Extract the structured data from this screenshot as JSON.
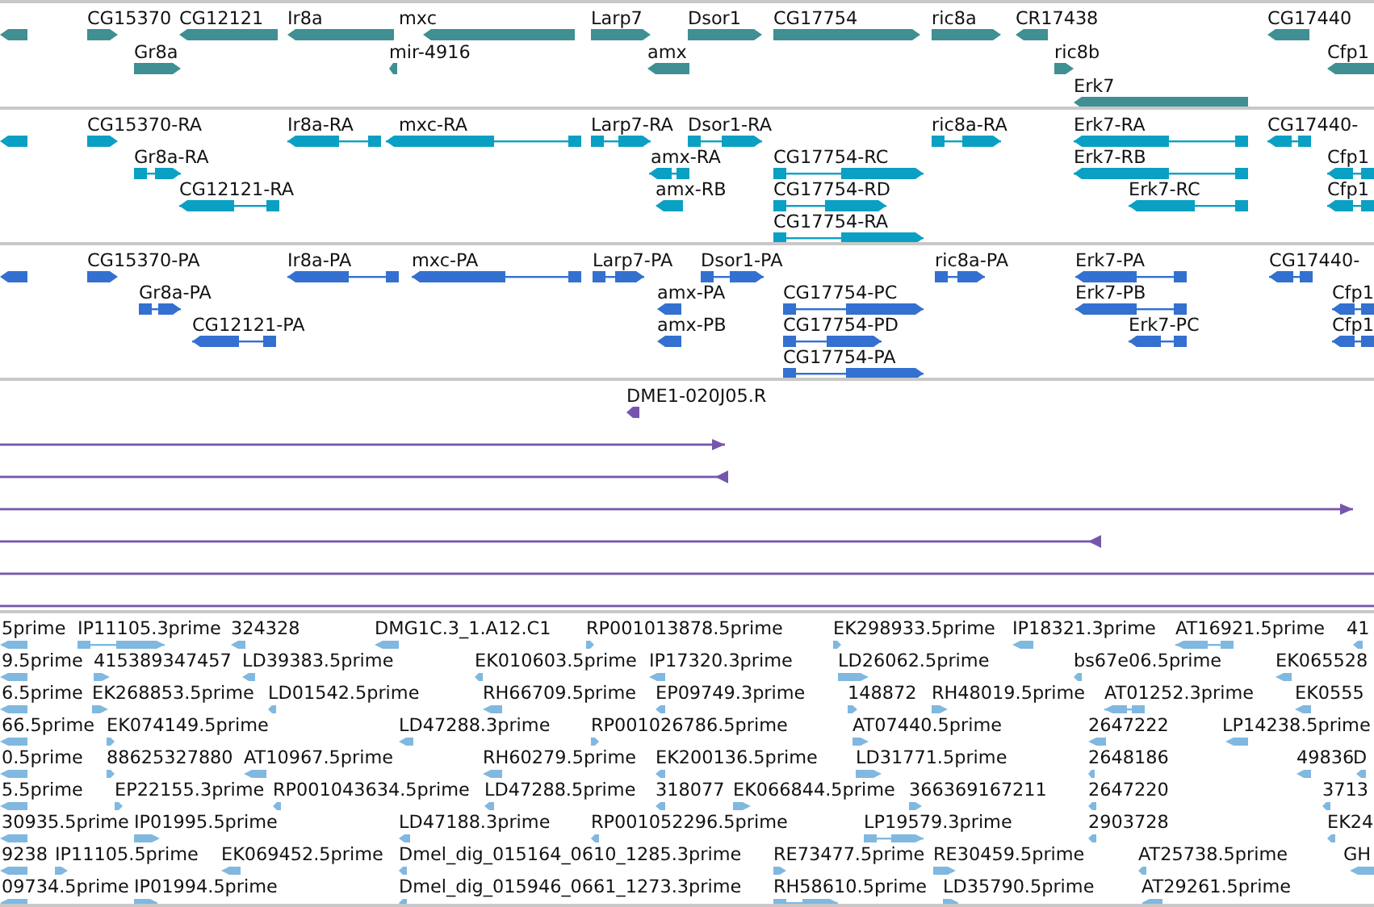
{
  "tracks": [
    {
      "kind": "gene",
      "color": "#3f8f93",
      "features": [
        {
          "reverse": true
        },
        {
          "label": "CG15370",
          "reverse": false
        },
        {
          "label": "CG12121",
          "reverse": true
        },
        {
          "label": "Ir8a",
          "reverse": true
        },
        {
          "label": "mxc",
          "reverse": true
        },
        {
          "label": "Larp7",
          "reverse": false
        },
        {
          "label": "Dsor1",
          "reverse": false
        },
        {
          "label": "CG17754",
          "reverse": false
        },
        {
          "label": "ric8a",
          "reverse": false
        },
        {
          "label": "CR17438",
          "reverse": true
        },
        {
          "label": "CG17440",
          "reverse": true
        },
        {
          "label": "Gr8a",
          "reverse": false
        },
        {
          "label": "mir-4916",
          "reverse": true
        },
        {
          "label": "amx",
          "reverse": true
        },
        {
          "label": "ric8b",
          "reverse": false
        },
        {
          "label": "Cfp1",
          "reverse": true
        },
        {
          "label": "Erk7",
          "reverse": true
        }
      ]
    },
    {
      "kind": "transcript",
      "color": "#0aa0c4",
      "features": [
        {
          "reverse": true
        },
        {
          "label": "CG15370-RA",
          "reverse": false
        },
        {
          "label": "Ir8a-RA",
          "reverse": true
        },
        {
          "label": "mxc-RA",
          "reverse": true
        },
        {
          "label": "Larp7-RA",
          "reverse": false
        },
        {
          "label": "Dsor1-RA",
          "reverse": false
        },
        {
          "label": "ric8a-RA",
          "reverse": false
        },
        {
          "label": "Erk7-RA",
          "reverse": true
        },
        {
          "label": "CG17440-",
          "reverse": true
        },
        {
          "label": "Gr8a-RA",
          "reverse": false
        },
        {
          "label": "amx-RA",
          "reverse": true
        },
        {
          "label": "CG17754-RC",
          "reverse": false
        },
        {
          "label": "Erk7-RB",
          "reverse": true
        },
        {
          "label": "Cfp1",
          "reverse": true
        },
        {
          "label": "CG12121-RA",
          "reverse": true
        },
        {
          "label": "amx-RB",
          "reverse": true
        },
        {
          "label": "CG17754-RD",
          "reverse": false
        },
        {
          "label": "Erk7-RC",
          "reverse": true
        },
        {
          "label": "Cfp1",
          "reverse": true
        },
        {
          "label": "CG17754-RA",
          "reverse": false
        }
      ]
    },
    {
      "kind": "transcript",
      "color": "#3370d0",
      "features": [
        {
          "reverse": true
        },
        {
          "label": "CG15370-PA",
          "reverse": false
        },
        {
          "label": "Ir8a-PA",
          "reverse": true
        },
        {
          "label": "mxc-PA",
          "reverse": true
        },
        {
          "label": "Larp7-PA",
          "reverse": false
        },
        {
          "label": "Dsor1-PA",
          "reverse": false
        },
        {
          "label": "ric8a-PA",
          "reverse": false
        },
        {
          "label": "Erk7-PA",
          "reverse": true
        },
        {
          "label": "CG17440-",
          "reverse": true
        },
        {
          "label": "Gr8a-PA",
          "reverse": false
        },
        {
          "label": "amx-PA",
          "reverse": true
        },
        {
          "label": "CG17754-PC",
          "reverse": false
        },
        {
          "label": "Erk7-PB",
          "reverse": true
        },
        {
          "label": "Cfp1",
          "reverse": true
        },
        {
          "label": "CG12121-PA",
          "reverse": true
        },
        {
          "label": "amx-PB",
          "reverse": true
        },
        {
          "label": "CG17754-PD",
          "reverse": false
        },
        {
          "label": "Erk7-PC",
          "reverse": true
        },
        {
          "label": "Cfp1",
          "reverse": true
        },
        {
          "label": "CG17754-PA",
          "reverse": false
        }
      ]
    },
    {
      "kind": "read",
      "color": "#7656ad",
      "features": [
        {
          "label": "DME1-020J05.R",
          "reverse": true
        },
        {
          "reverse": false
        },
        {
          "reverse": true
        },
        {
          "reverse": false
        },
        {
          "reverse": true
        },
        {
          "arrow": false
        },
        {
          "arrow": false
        }
      ]
    },
    {
      "kind": "est",
      "color": "#80b8e0",
      "features": [
        {
          "label": "5prime",
          "reverse": true
        },
        {
          "label": "IP11105.3prime",
          "reverse": false
        },
        {
          "label": "324328",
          "reverse": true
        },
        {
          "label": "DMG1C.3_1.A12.C1",
          "reverse": true
        },
        {
          "label": "RP001013878.5prime",
          "reverse": false
        },
        {
          "label": "EK298933.5prime",
          "reverse": false
        },
        {
          "label": "IP18321.3prime",
          "reverse": true
        },
        {
          "label": "AT16921.5prime",
          "reverse": true
        },
        {
          "label": "41",
          "reverse": true
        },
        {
          "label": "9.5prime",
          "reverse": true
        },
        {
          "label": "415389347457",
          "reverse": false
        },
        {
          "label": "LD39383.5prime",
          "reverse": true
        },
        {
          "label": "EK010603.5prime",
          "reverse": true
        },
        {
          "label": "IP17320.3prime",
          "reverse": true
        },
        {
          "label": "LD26062.5prime",
          "reverse": false
        },
        {
          "label": "bs67e06.5prime",
          "reverse": true
        },
        {
          "label": "EK065528",
          "reverse": true
        },
        {
          "label": "6.5prime",
          "reverse": true
        },
        {
          "label": "EK268853.5prime",
          "reverse": false
        },
        {
          "label": "LD01542.5prime",
          "reverse": true
        },
        {
          "label": "RH66709.5prime",
          "reverse": true
        },
        {
          "label": "EP09749.3prime",
          "reverse": true
        },
        {
          "label": "148872",
          "reverse": false
        },
        {
          "label": "RH48019.5prime",
          "reverse": false
        },
        {
          "label": "AT01252.3prime",
          "reverse": true
        },
        {
          "label": "EK0555",
          "reverse": true
        },
        {
          "label": "66.5prime",
          "reverse": true
        },
        {
          "label": "EK074149.5prime",
          "reverse": false
        },
        {
          "label": "LD47288.3prime",
          "reverse": true
        },
        {
          "label": "RP001026786.5prime",
          "reverse": false
        },
        {
          "label": "AT07440.5prime",
          "reverse": false
        },
        {
          "label": "2647222",
          "reverse": true
        },
        {
          "label": "LP14238.5prime",
          "reverse": true
        },
        {
          "label": "0.5prime",
          "reverse": true
        },
        {
          "label": "88625327880",
          "reverse": false
        },
        {
          "label": "AT10967.5prime",
          "reverse": true
        },
        {
          "label": "RH60279.5prime",
          "reverse": true
        },
        {
          "label": "EK200136.5prime",
          "reverse": true
        },
        {
          "label": "LD31771.5prime",
          "reverse": false
        },
        {
          "label": "2648186",
          "reverse": true
        },
        {
          "label": "49836",
          "reverse": true
        },
        {
          "label": "D",
          "reverse": true
        },
        {
          "label": "5.5prime",
          "reverse": true
        },
        {
          "label": "EP22155.3prime",
          "reverse": false
        },
        {
          "label": "RP001043634.5prime",
          "reverse": true
        },
        {
          "label": "LD47288.5prime",
          "reverse": true
        },
        {
          "label": "318077",
          "reverse": true
        },
        {
          "label": "EK066844.5prime",
          "reverse": false
        },
        {
          "label": "366369167211",
          "reverse": false
        },
        {
          "label": "2647220",
          "reverse": true
        },
        {
          "label": "3713",
          "reverse": true
        },
        {
          "label": "30935.5prime",
          "reverse": true
        },
        {
          "label": "IP01995.5prime",
          "reverse": false
        },
        {
          "label": "LD47188.3prime",
          "reverse": true
        },
        {
          "label": "RP001052296.5prime",
          "reverse": true
        },
        {
          "label": "LP19579.3prime",
          "reverse": false
        },
        {
          "label": "2903728",
          "reverse": true
        },
        {
          "label": "EK24",
          "reverse": true
        },
        {
          "label": "9238",
          "reverse": true
        },
        {
          "label": "IP11105.5prime",
          "reverse": false
        },
        {
          "label": "EK069452.5prime",
          "reverse": true
        },
        {
          "label": "Dmel_dig_015164_0610_1285.3prime",
          "reverse": true
        },
        {
          "label": "RE73477.5prime",
          "reverse": false
        },
        {
          "label": "RE30459.5prime",
          "reverse": false
        },
        {
          "label": "AT25738.5prime",
          "reverse": true
        },
        {
          "label": "GH",
          "reverse": true
        },
        {
          "label": "09734.5prime",
          "reverse": true
        },
        {
          "label": "IP01994.5prime",
          "reverse": false
        },
        {
          "label": "Dmel_dig_015946_0661_1273.3prime",
          "reverse": true
        },
        {
          "label": "RH58610.5prime",
          "reverse": false
        },
        {
          "label": "LD35790.5prime",
          "reverse": false
        },
        {
          "label": "AT29261.5prime",
          "reverse": true
        }
      ]
    }
  ]
}
